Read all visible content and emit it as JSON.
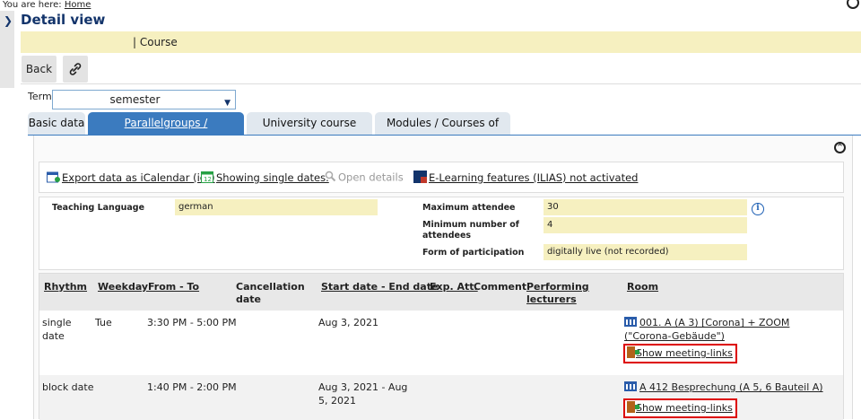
{
  "breadcrumb": {
    "prefix": "You are here:",
    "home": "Home"
  },
  "page": {
    "title": "Detail view",
    "course_line": "| Course"
  },
  "buttons": {
    "back": "Back"
  },
  "term": {
    "label": "Term",
    "value": "semester"
  },
  "tabs": [
    "Basic data",
    "Parallelgroups / Appointments",
    "University course catalog",
    "Modules / Courses of study"
  ],
  "actions": {
    "ical": "Export data as iCalendar (ics)",
    "single_dates": "Showing single dates.",
    "open_details": "Open details",
    "elearning": "E-Learning features (ILIAS) not activated"
  },
  "info": {
    "teaching_language_label": "Teaching Language",
    "teaching_language": "german",
    "max_attendee_label": "Maximum attendee",
    "max_attendee": "30",
    "min_attendees_label": "Minimum number of attendees",
    "min_attendees": "4",
    "form_label": "Form of participation",
    "form": "digitally live (not recorded)"
  },
  "table": {
    "headers": [
      "Rhythm",
      "Weekday",
      "From - To",
      "Cancellation date",
      "Start date - End date",
      "Exp. Att.",
      "Comment",
      "Performing lecturers",
      "Room"
    ],
    "rows": [
      {
        "rhythm": "single date",
        "weekday": "Tue",
        "time": "3:30 PM - 5:00 PM",
        "dates": "Aug 3, 2021",
        "room": "001. A (A 3) [Corona] + ZOOM (\"Corona-Gebäude\")",
        "meeting": "Show meeting-links"
      },
      {
        "rhythm": "block date",
        "weekday": "",
        "time": "1:40 PM - 2:00 PM",
        "dates": "Aug 3, 2021 - Aug 5, 2021",
        "room": "A 412 Besprechung (A 5, 6 Bauteil A)",
        "meeting": "Show meeting-links"
      }
    ]
  },
  "colors": {
    "accent": "#3b7bbf",
    "highlight": "#f6f0c0",
    "title": "#13346b",
    "meeting_border": "#dd0000"
  }
}
